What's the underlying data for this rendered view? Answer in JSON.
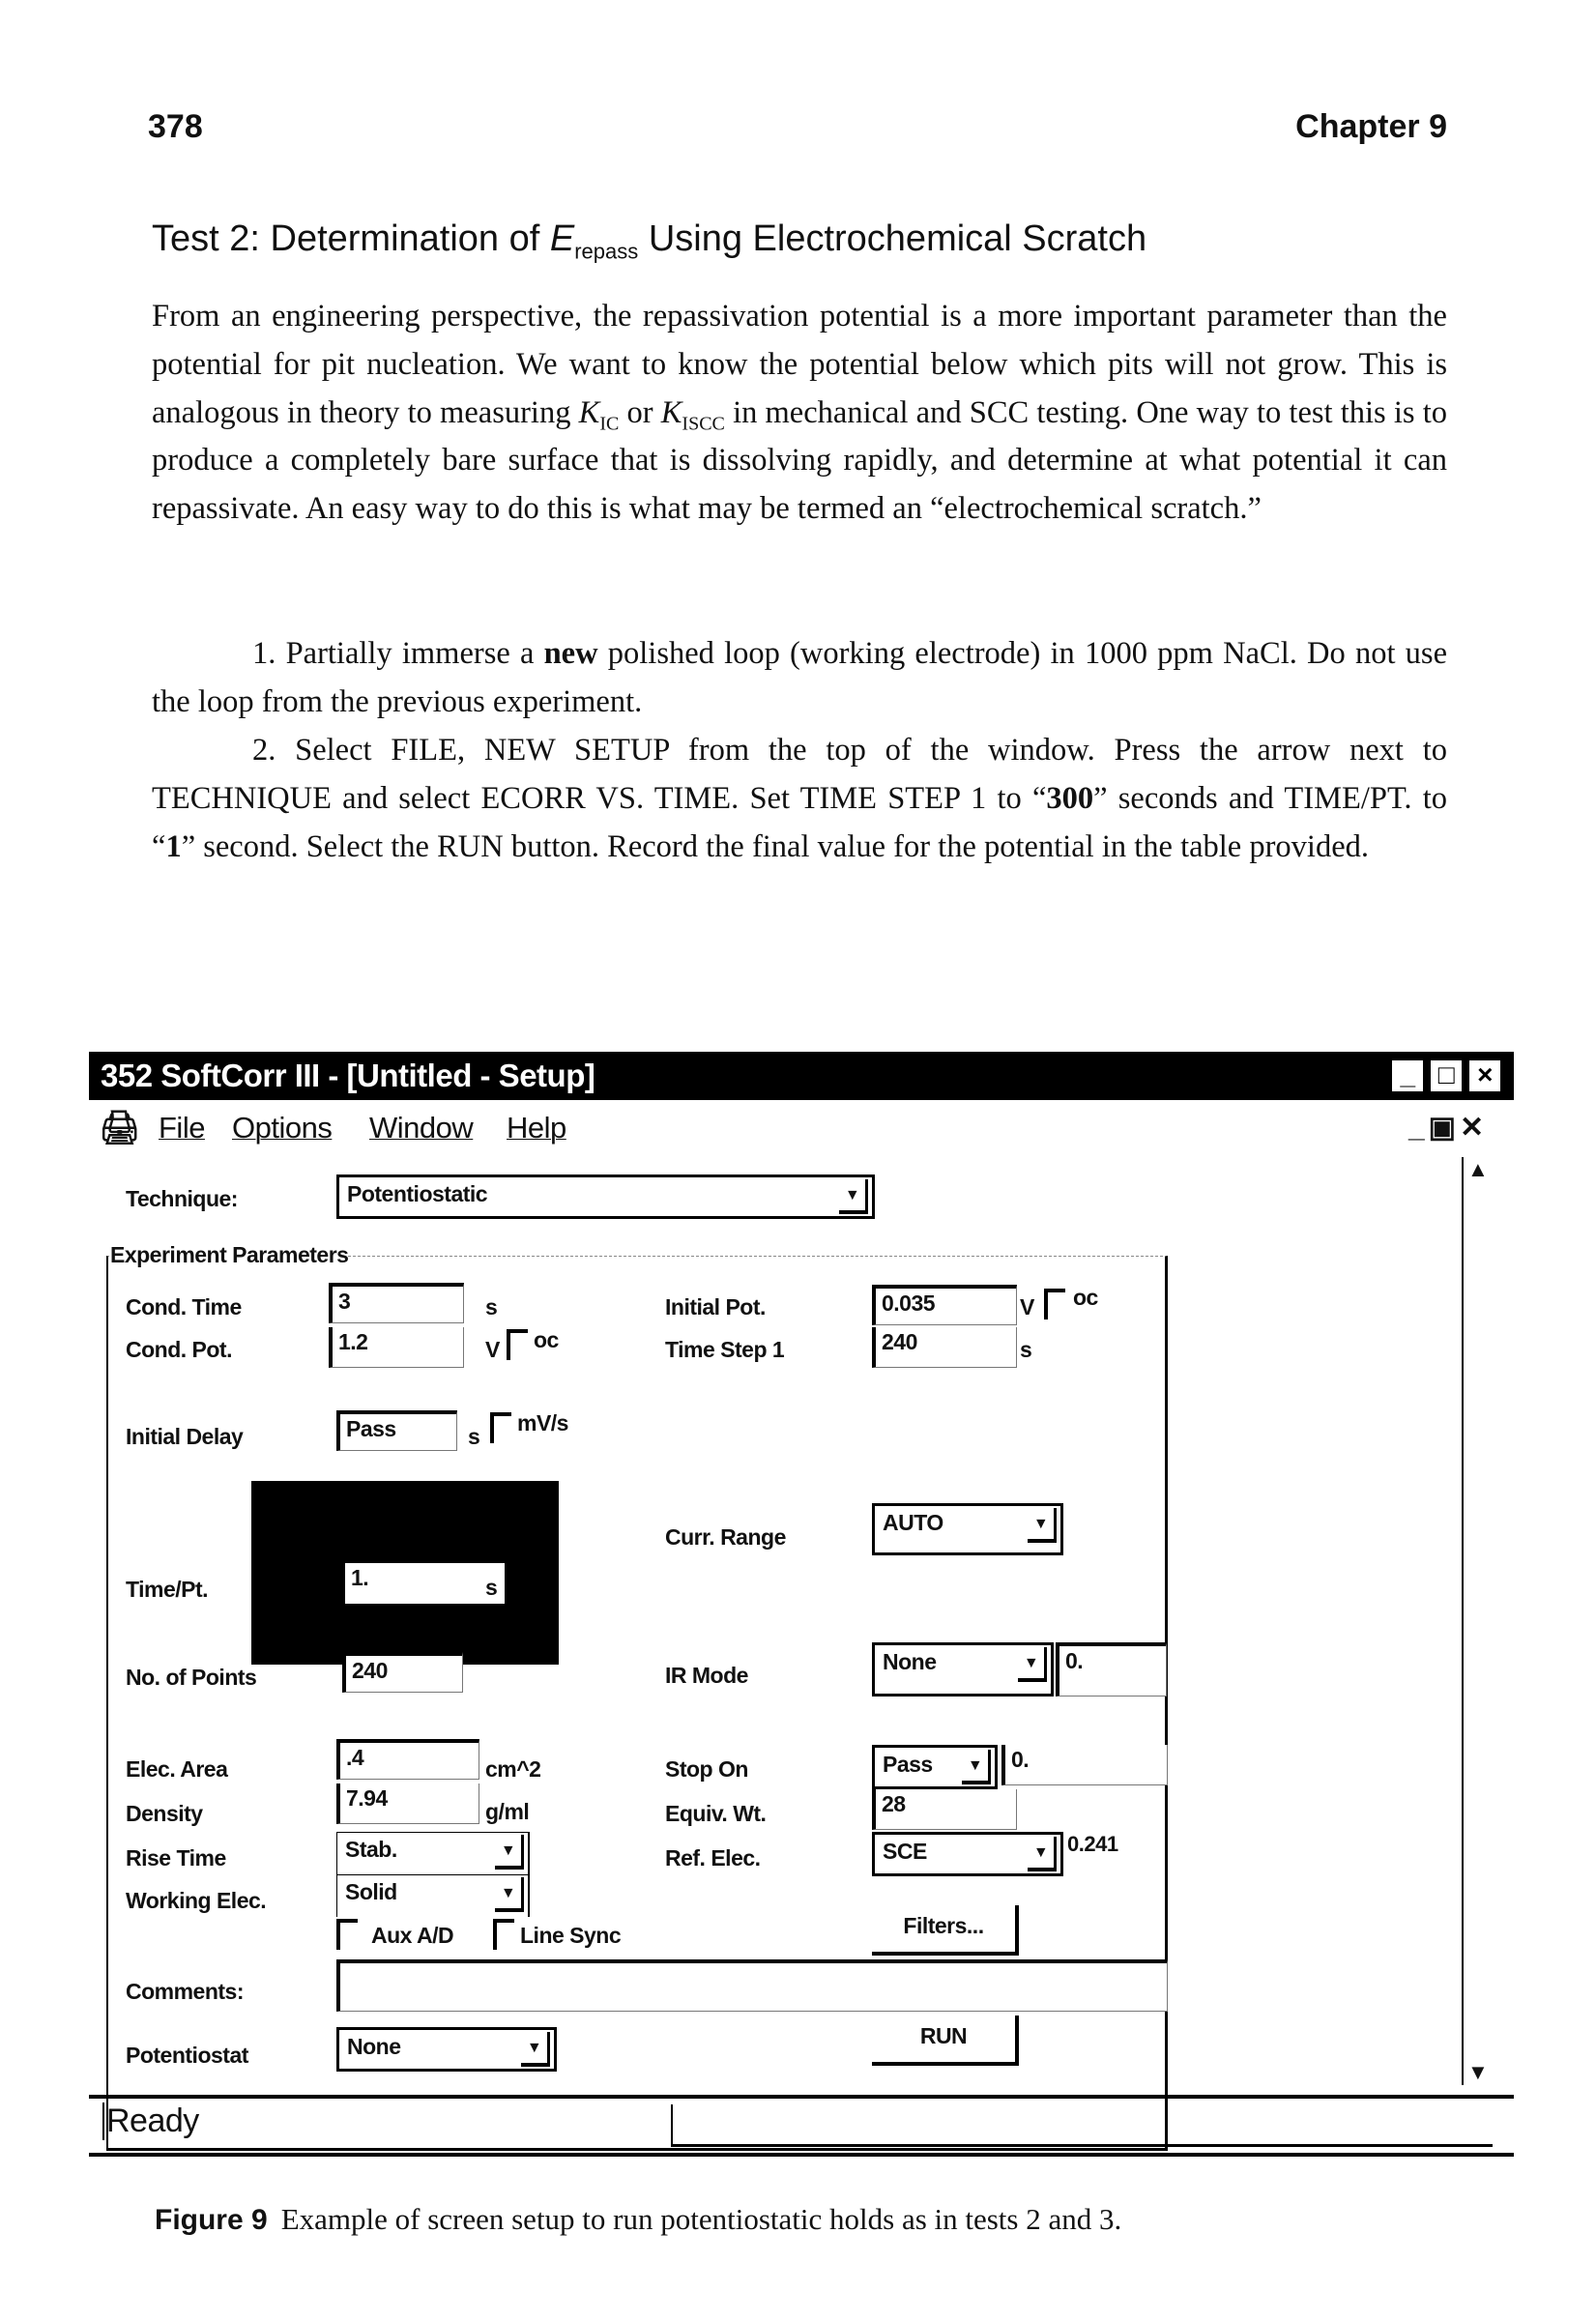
{
  "page": {
    "number": "378",
    "chapter": "Chapter 9"
  },
  "section": {
    "pre": "Test 2: Determination of ",
    "var": "E",
    "sub": "repass",
    "post": " Using Electrochemical Scratch"
  },
  "paragraphs": {
    "p1": {
      "t1": "From an engineering perspective, the repassivation potential is a more important parameter than the potential for pit nucleation. We want to know the potential below which pits will not grow. This is analogous in theory to measuring ",
      "k1": "K",
      "k1sub": "IC",
      "t2": " or ",
      "k2": "K",
      "k2sub": "ISCC",
      "t3": " in mechanical and SCC testing. One way to test this is to produce a completely bare surface that is dissolving rapidly, and determine at what potential it can repassivate. An easy way to do this is what may be termed an “electrochemical scratch.”"
    },
    "p2": {
      "t1": "1.  Partially immerse a ",
      "b1": "new",
      "t2": " polished loop (working electrode) in 1000 ppm NaCl. Do not use the loop from the previous experiment."
    },
    "p3": {
      "t1": "2.  Select FILE, NEW SETUP from the top of the window. Press the arrow next to TECHNIQUE and select ECORR VS. TIME. Set TIME STEP 1 to “",
      "b1": "300",
      "t2": "” seconds and TIME/PT. to “",
      "b2": "1",
      "t3": "” second. Select the RUN button. Record the final value for the potential in the table provided."
    }
  },
  "window": {
    "title": "352 SoftCorr III - [Untitled - Setup]",
    "menu": [
      "File",
      "Options",
      "Window",
      "Help"
    ],
    "technique_label": "Technique:",
    "technique": "Potentiostatic",
    "group": "Experiment Parameters",
    "left": {
      "cond_time": {
        "label": "Cond. Time",
        "value": "3",
        "unit": "s"
      },
      "cond_pot": {
        "label": "Cond. Pot.",
        "value": "1.2",
        "unit": "V",
        "check": "oc"
      },
      "initial_delay": {
        "label": "Initial Delay",
        "value": "Pass",
        "unit": "s",
        "check": "mV/s"
      },
      "time_pt": {
        "label": "Time/Pt.",
        "value": "1.",
        "unit": "s"
      },
      "points": {
        "label": "No. of Points",
        "value": "240"
      },
      "elec_area": {
        "label": "Elec. Area",
        "value": ".4",
        "unit": "cm^2"
      },
      "density": {
        "label": "Density",
        "value": "7.94",
        "unit": "g/ml"
      },
      "rise_time": {
        "label": "Rise Time",
        "value": "Stab."
      },
      "working_elec": {
        "label": "Working Elec.",
        "value": "Solid"
      },
      "aux": "Aux A/D",
      "line_sync": "Line Sync",
      "comments": {
        "label": "Comments:",
        "value": ""
      },
      "potentiostat": {
        "label": "Potentiostat",
        "value": "None"
      }
    },
    "right": {
      "initial_pot": {
        "label": "Initial Pot.",
        "value": "0.035",
        "unit": "V",
        "check": "oc"
      },
      "time_step": {
        "label": "Time Step 1",
        "value": "240",
        "unit": "s"
      },
      "curr_range": {
        "label": "Curr. Range",
        "value": "AUTO"
      },
      "ir_mode": {
        "label": "IR Mode",
        "value": "None",
        "extra": "0."
      },
      "stop_on": {
        "label": "Stop On",
        "value": "Pass",
        "extra": "0."
      },
      "equiv": {
        "label": "Equiv. Wt.",
        "value": "28"
      },
      "ref_elec": {
        "label": "Ref. Elec.",
        "value": "SCE",
        "extra": "0.241"
      },
      "filters": "Filters...",
      "run": "RUN"
    },
    "status": "Ready"
  },
  "caption": {
    "label": "Figure 9",
    "text": "Example of screen setup to run potentiostatic holds as in tests 2 and 3."
  }
}
